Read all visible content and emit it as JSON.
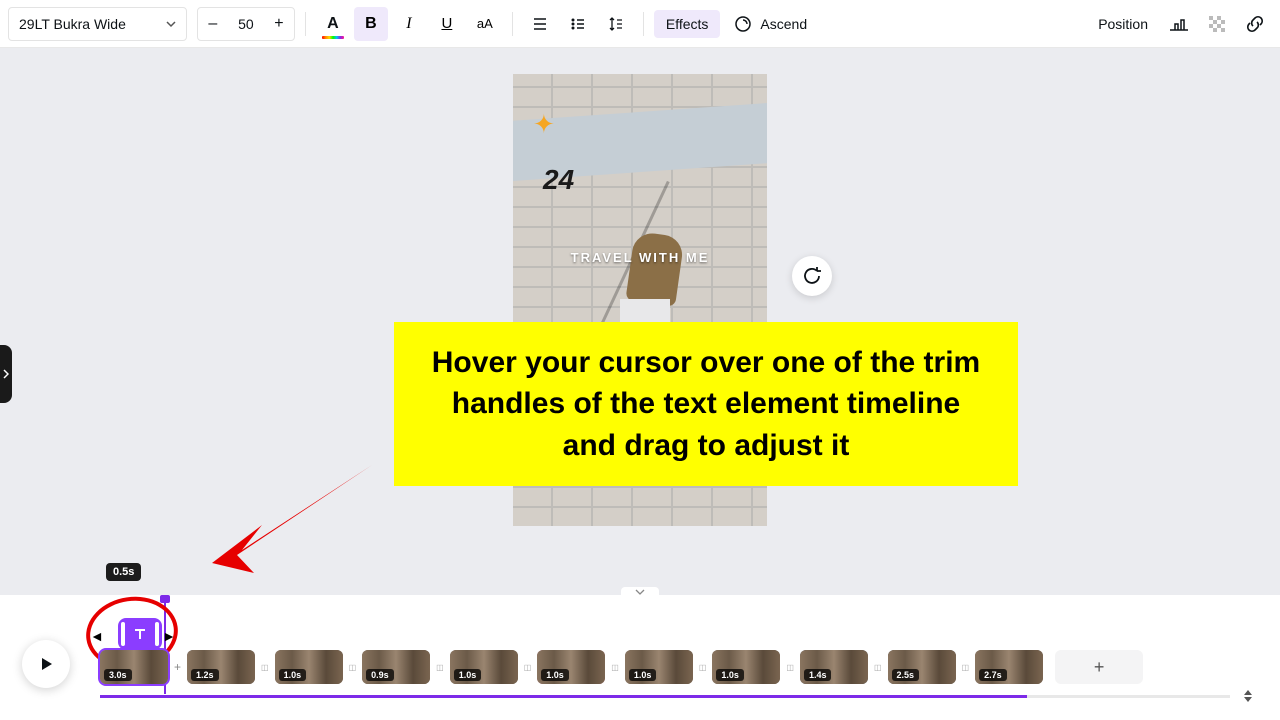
{
  "toolbar": {
    "font_name": "29LT Bukra Wide",
    "font_size": "50",
    "effects_label": "Effects",
    "animate_label": "Ascend",
    "position_label": "Position"
  },
  "canvas": {
    "sparkle": "✦",
    "num": "24",
    "travel_text": "TRAVEL WITH ME"
  },
  "callout": {
    "text": "Hover your cursor over one of the trim handles of the text element timeline and drag to adjust it"
  },
  "timeline": {
    "text_clip_duration": "0.5s",
    "clips": [
      {
        "dur": "3.0s"
      },
      {
        "dur": "1.2s"
      },
      {
        "dur": "1.0s"
      },
      {
        "dur": "0.9s"
      },
      {
        "dur": "1.0s"
      },
      {
        "dur": "1.0s"
      },
      {
        "dur": "1.0s"
      },
      {
        "dur": "1.0s"
      },
      {
        "dur": "1.4s"
      },
      {
        "dur": "2.5s"
      },
      {
        "dur": "2.7s"
      }
    ]
  }
}
